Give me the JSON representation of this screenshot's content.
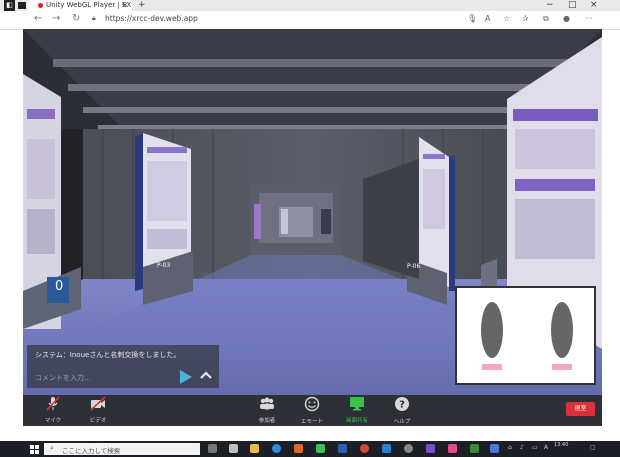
{
  "browser": {
    "tab_title": "Unity WebGL Player | EXPC",
    "tab_close": "×",
    "new_tab": "+",
    "url": "https://xrcc-dev.web.app",
    "win_minimize": "−",
    "win_maximize": "□",
    "win_close": "×",
    "more_menu": "···"
  },
  "scene": {
    "counter_label": "0",
    "sign_left": "P-03",
    "sign_right": "P-06"
  },
  "chat": {
    "message": "システム：Inoueさんと名刺交換をしました。",
    "input_placeholder": "コメントを入力..."
  },
  "toolbar": {
    "mic_label": "マイク",
    "video_label": "ビデオ",
    "participants_label": "参加者",
    "emote_label": "エモート",
    "screen_share_label": "画面共有",
    "help_label": "ヘルプ",
    "help_glyph": "?",
    "exit_label": "退室",
    "active_color": "#39c24a",
    "exit_color": "#d9323a"
  },
  "taskbar": {
    "search_placeholder": "ここに入力して検索",
    "clock_time": "13:40"
  }
}
